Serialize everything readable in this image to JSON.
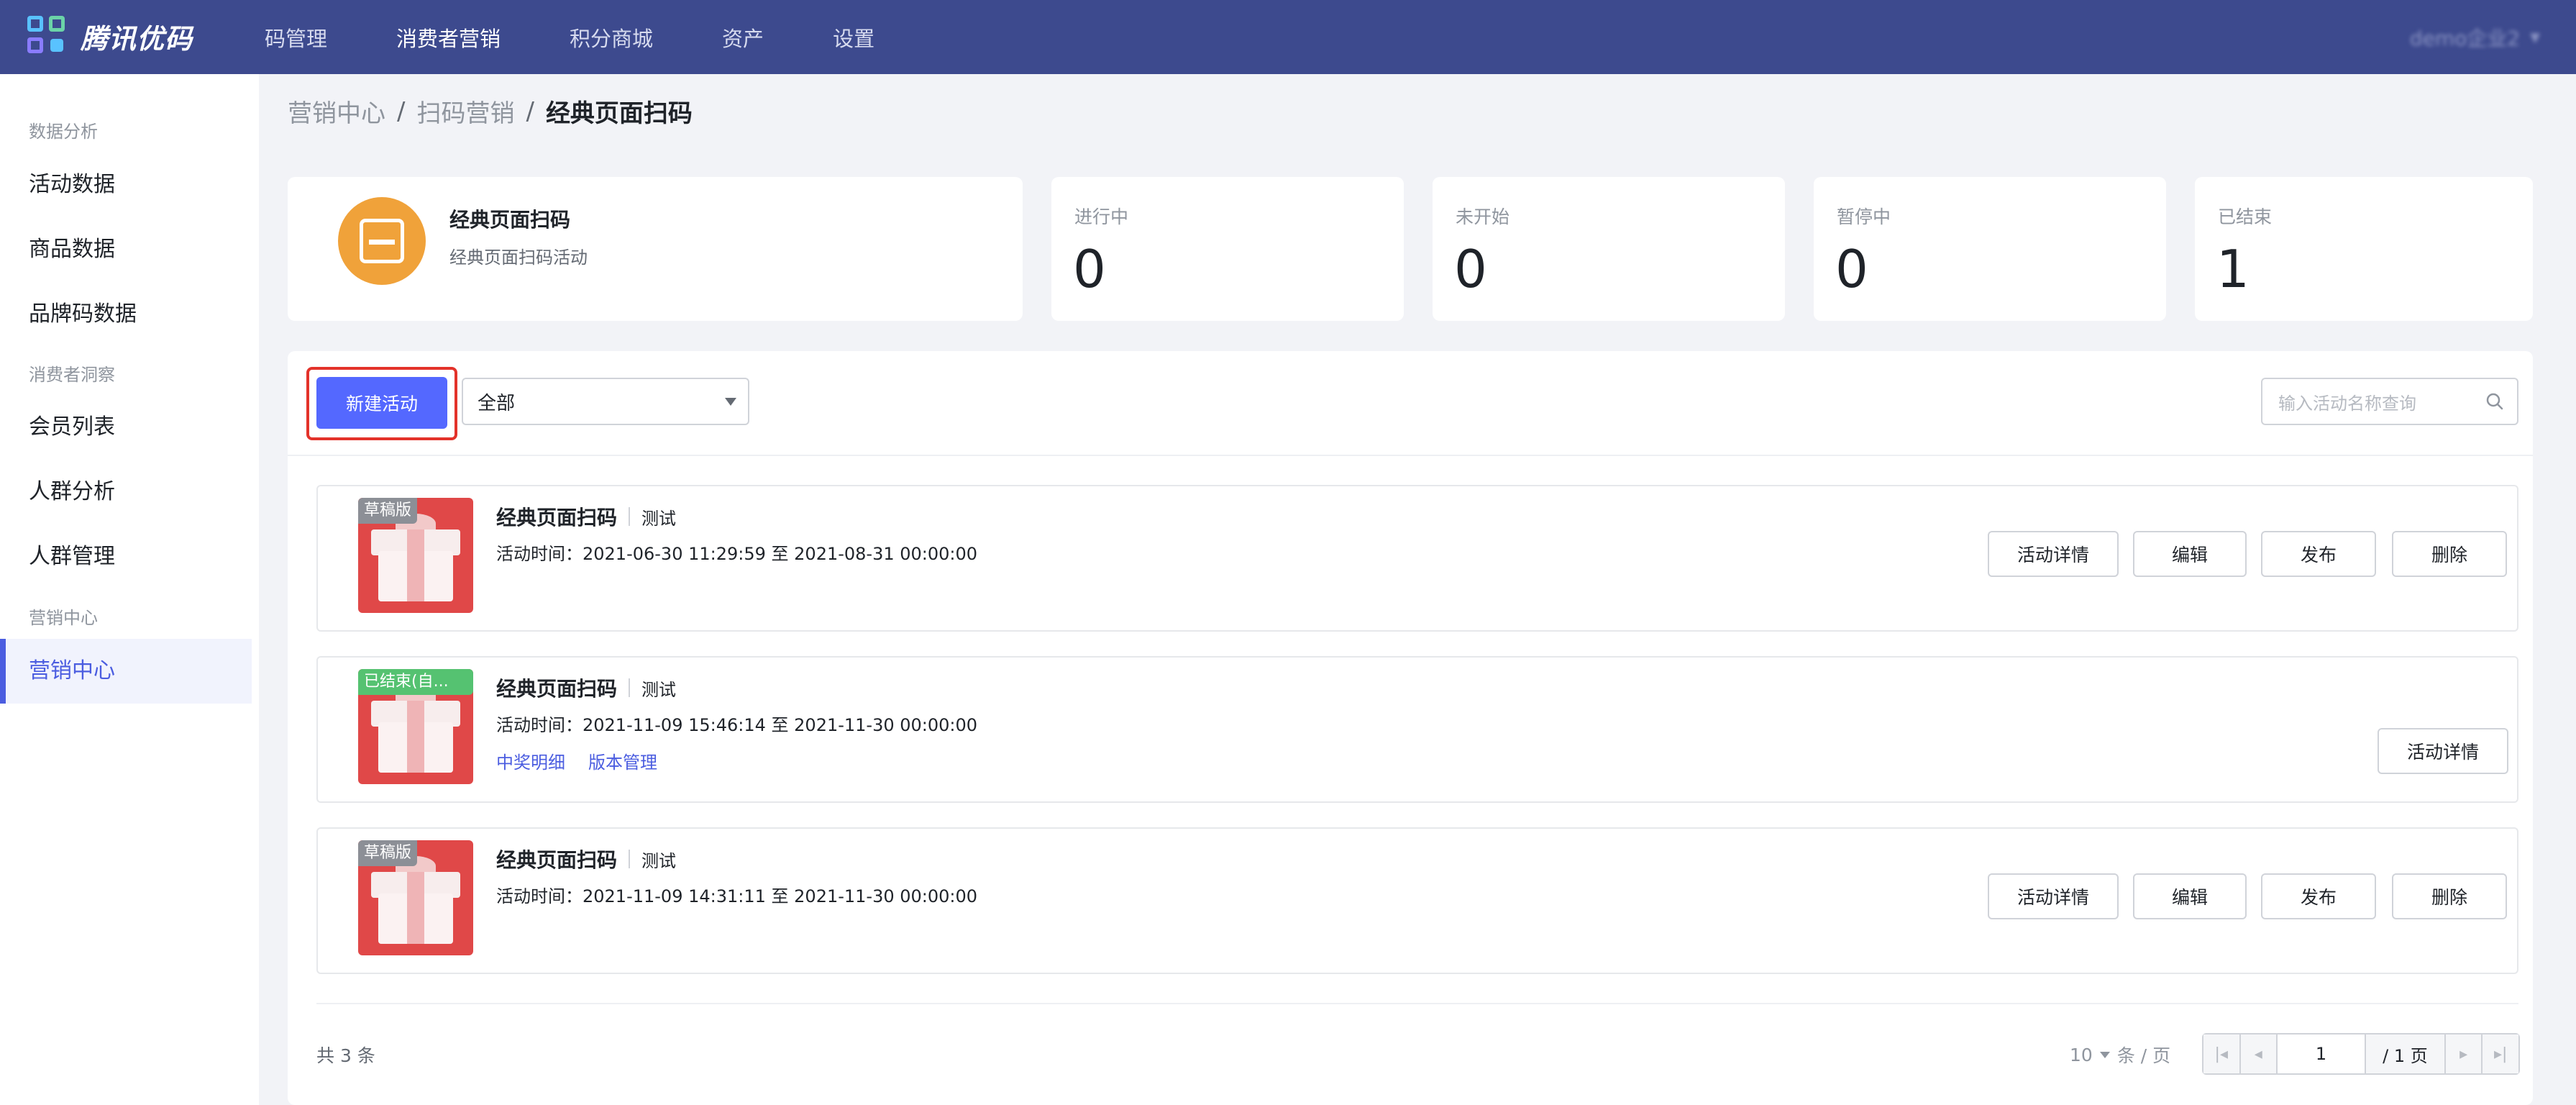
{
  "app": {
    "logo_text": "腾讯优码",
    "user_name": "demo企业2"
  },
  "nav": {
    "items": [
      "码管理",
      "消费者营销",
      "积分商城",
      "资产",
      "设置"
    ],
    "active": "消费者营销"
  },
  "sidebar": {
    "groups": [
      {
        "label": "数据分析",
        "items": [
          "活动数据",
          "商品数据",
          "品牌码数据"
        ]
      },
      {
        "label": "消费者洞察",
        "items": [
          "会员列表",
          "人群分析",
          "人群管理"
        ]
      },
      {
        "label": "营销中心",
        "items": [
          "营销中心"
        ]
      }
    ],
    "active_item": "营销中心"
  },
  "breadcrumb": {
    "items": [
      "营销中心",
      "扫码营销",
      "经典页面扫码"
    ],
    "separator": "/"
  },
  "intro": {
    "title": "经典页面扫码",
    "subtitle": "经典页面扫码活动"
  },
  "stats": [
    {
      "label": "进行中",
      "value": "0"
    },
    {
      "label": "未开始",
      "value": "0"
    },
    {
      "label": "暂停中",
      "value": "0"
    },
    {
      "label": "已结束",
      "value": "1"
    }
  ],
  "toolbar": {
    "new_button": "新建活动",
    "filter_value": "全部",
    "search_placeholder": "输入活动名称查询"
  },
  "activities": [
    {
      "status_tag": "草稿版",
      "title": "经典页面扫码",
      "tag": "测试",
      "time": "活动时间：2021-06-30 11:29:59 至 2021-08-31 00:00:00",
      "links": [],
      "actions": [
        "活动详情",
        "编辑",
        "发布",
        "删除"
      ]
    },
    {
      "status_tag": "已结束(自...",
      "title": "经典页面扫码",
      "tag": "测试",
      "time": "活动时间：2021-11-09 15:46:14 至 2021-11-30 00:00:00",
      "links": [
        "中奖明细",
        "版本管理"
      ],
      "actions": [
        "活动详情"
      ]
    },
    {
      "status_tag": "草稿版",
      "title": "经典页面扫码",
      "tag": "测试",
      "time": "活动时间：2021-11-09 14:31:11 至 2021-11-30 00:00:00",
      "links": [],
      "actions": [
        "活动详情",
        "编辑",
        "发布",
        "删除"
      ]
    }
  ],
  "footer": {
    "total": "共 3 条",
    "page_size": "10",
    "page_size_unit": "条 / 页",
    "current_page": "1",
    "total_pages": "/ 1 页"
  },
  "colors": {
    "topbar": "#3d4a8e",
    "primary": "#5468ff",
    "highlight": "#e3322a",
    "draft_tag": "#8c8f96",
    "ended_tag": "#55c271",
    "intro_icon": "#f0a23a"
  }
}
